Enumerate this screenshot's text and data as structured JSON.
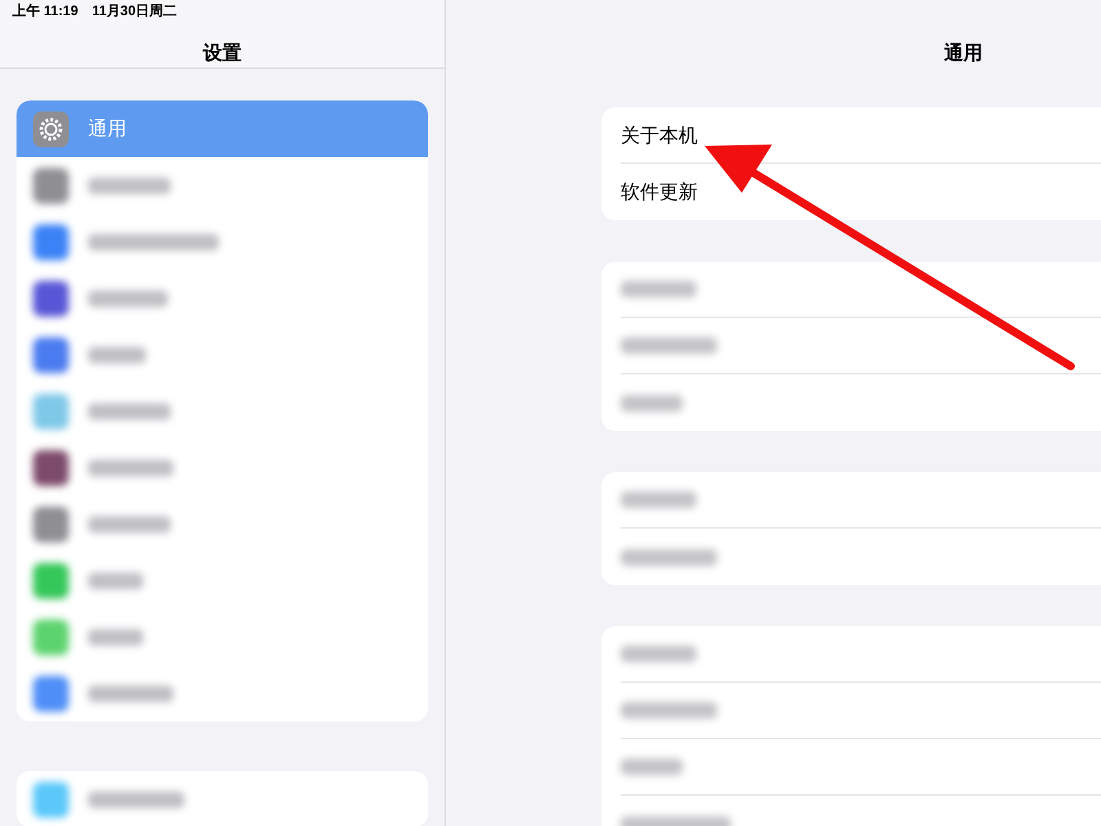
{
  "status_bar": {
    "time": "上午 11:19",
    "date": "11月30日周二"
  },
  "sidebar": {
    "title": "设置",
    "groups": [
      {
        "items": [
          {
            "kind": "item",
            "label": "通用",
            "selected": true
          },
          {
            "kind": "blurred",
            "color": "#8e8e93",
            "selected": false
          },
          {
            "kind": "blurred",
            "color": "#3b82f6",
            "selected": false
          },
          {
            "kind": "blurred",
            "color": "#5856d6",
            "selected": false
          },
          {
            "kind": "blurred",
            "color": "#4a7bf0",
            "selected": false
          },
          {
            "kind": "blurred",
            "color": "#7fc8e8",
            "selected": false
          },
          {
            "kind": "blurred",
            "color": "#7c4a6a",
            "selected": false
          },
          {
            "kind": "blurred",
            "color": "#8e8e93",
            "selected": false
          },
          {
            "kind": "blurred",
            "color": "#34c759",
            "selected": false
          },
          {
            "kind": "blurred",
            "color": "#5cd36e",
            "selected": false
          },
          {
            "kind": "blurred",
            "color": "#4f8ef7",
            "selected": false
          }
        ]
      },
      {
        "items": [
          {
            "kind": "blurred",
            "color": "#5ac8fa",
            "selected": false
          }
        ]
      }
    ]
  },
  "detail": {
    "title": "通用",
    "groups": [
      {
        "rows": [
          {
            "kind": "item",
            "label": "关于本机"
          },
          {
            "kind": "item",
            "label": "软件更新"
          }
        ]
      },
      {
        "rows": [
          {
            "kind": "blurred"
          },
          {
            "kind": "blurred"
          },
          {
            "kind": "blurred"
          }
        ]
      },
      {
        "rows": [
          {
            "kind": "blurred"
          },
          {
            "kind": "blurred"
          }
        ]
      },
      {
        "rows": [
          {
            "kind": "blurred"
          },
          {
            "kind": "blurred"
          },
          {
            "kind": "blurred"
          },
          {
            "kind": "blurred"
          }
        ]
      }
    ]
  }
}
